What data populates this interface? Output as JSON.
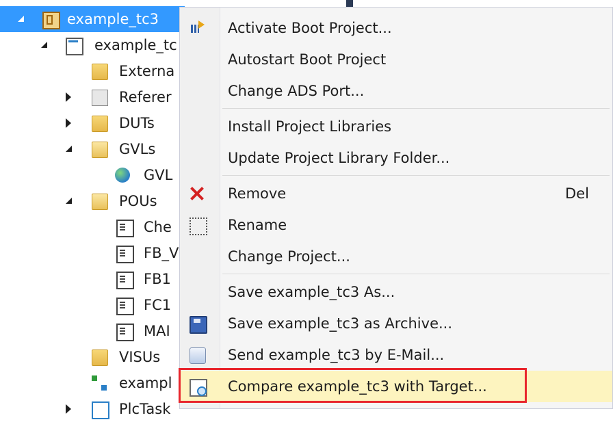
{
  "tree": {
    "items": [
      {
        "label": "example_tc3",
        "icon": "twincat-project-icon",
        "arrow": "expanded",
        "selected": true
      },
      {
        "label": "example_tc",
        "icon": "plc-project-icon",
        "arrow": "expanded"
      },
      {
        "label": "Externa",
        "icon": "folder-icon",
        "arrow": ""
      },
      {
        "label": "Referer",
        "icon": "references-icon",
        "arrow": "collapsed"
      },
      {
        "label": "DUTs",
        "icon": "folder-icon",
        "arrow": "collapsed"
      },
      {
        "label": "GVLs",
        "icon": "folder-open-icon",
        "arrow": "expanded"
      },
      {
        "label": "GVL",
        "icon": "globe-icon",
        "arrow": ""
      },
      {
        "label": "POUs",
        "icon": "folder-open-icon",
        "arrow": "expanded"
      },
      {
        "label": "Che",
        "icon": "pou-icon",
        "arrow": ""
      },
      {
        "label": "FB_V",
        "icon": "pou-icon",
        "arrow": ""
      },
      {
        "label": "FB1",
        "icon": "pou-icon",
        "arrow": ""
      },
      {
        "label": "FC1",
        "icon": "pou-icon",
        "arrow": ""
      },
      {
        "label": "MAI",
        "icon": "pou-icon",
        "arrow": ""
      },
      {
        "label": "VISUs",
        "icon": "folder-icon",
        "arrow": ""
      },
      {
        "label": "exampl",
        "icon": "task-network-icon",
        "arrow": ""
      },
      {
        "label": "PlcTask",
        "icon": "plc-task-icon",
        "arrow": "collapsed"
      }
    ]
  },
  "menu": {
    "items": [
      {
        "label": "Activate Boot Project...",
        "icon": "boot-project-icon"
      },
      {
        "label": "Autostart Boot Project",
        "icon": ""
      },
      {
        "label": "Change ADS Port...",
        "icon": ""
      },
      {
        "label": "Install Project Libraries",
        "icon": ""
      },
      {
        "label": "Update Project Library Folder...",
        "icon": ""
      },
      {
        "label": "Remove",
        "icon": "remove-x-icon",
        "shortcut": "Del"
      },
      {
        "label": "Rename",
        "icon": "rename-icon"
      },
      {
        "label": "Change Project...",
        "icon": ""
      },
      {
        "label": "Save example_tc3 As...",
        "icon": ""
      },
      {
        "label": "Save example_tc3 as Archive...",
        "icon": "save-archive-icon"
      },
      {
        "label": "Send example_tc3 by E-Mail...",
        "icon": "email-icon"
      },
      {
        "label": "Compare example_tc3 with Target...",
        "icon": "compare-icon",
        "highlighted": true
      }
    ]
  },
  "colors": {
    "selection": "#3399ff",
    "menu_highlight": "#fdf4bf",
    "annotation_border": "#e8262d"
  }
}
